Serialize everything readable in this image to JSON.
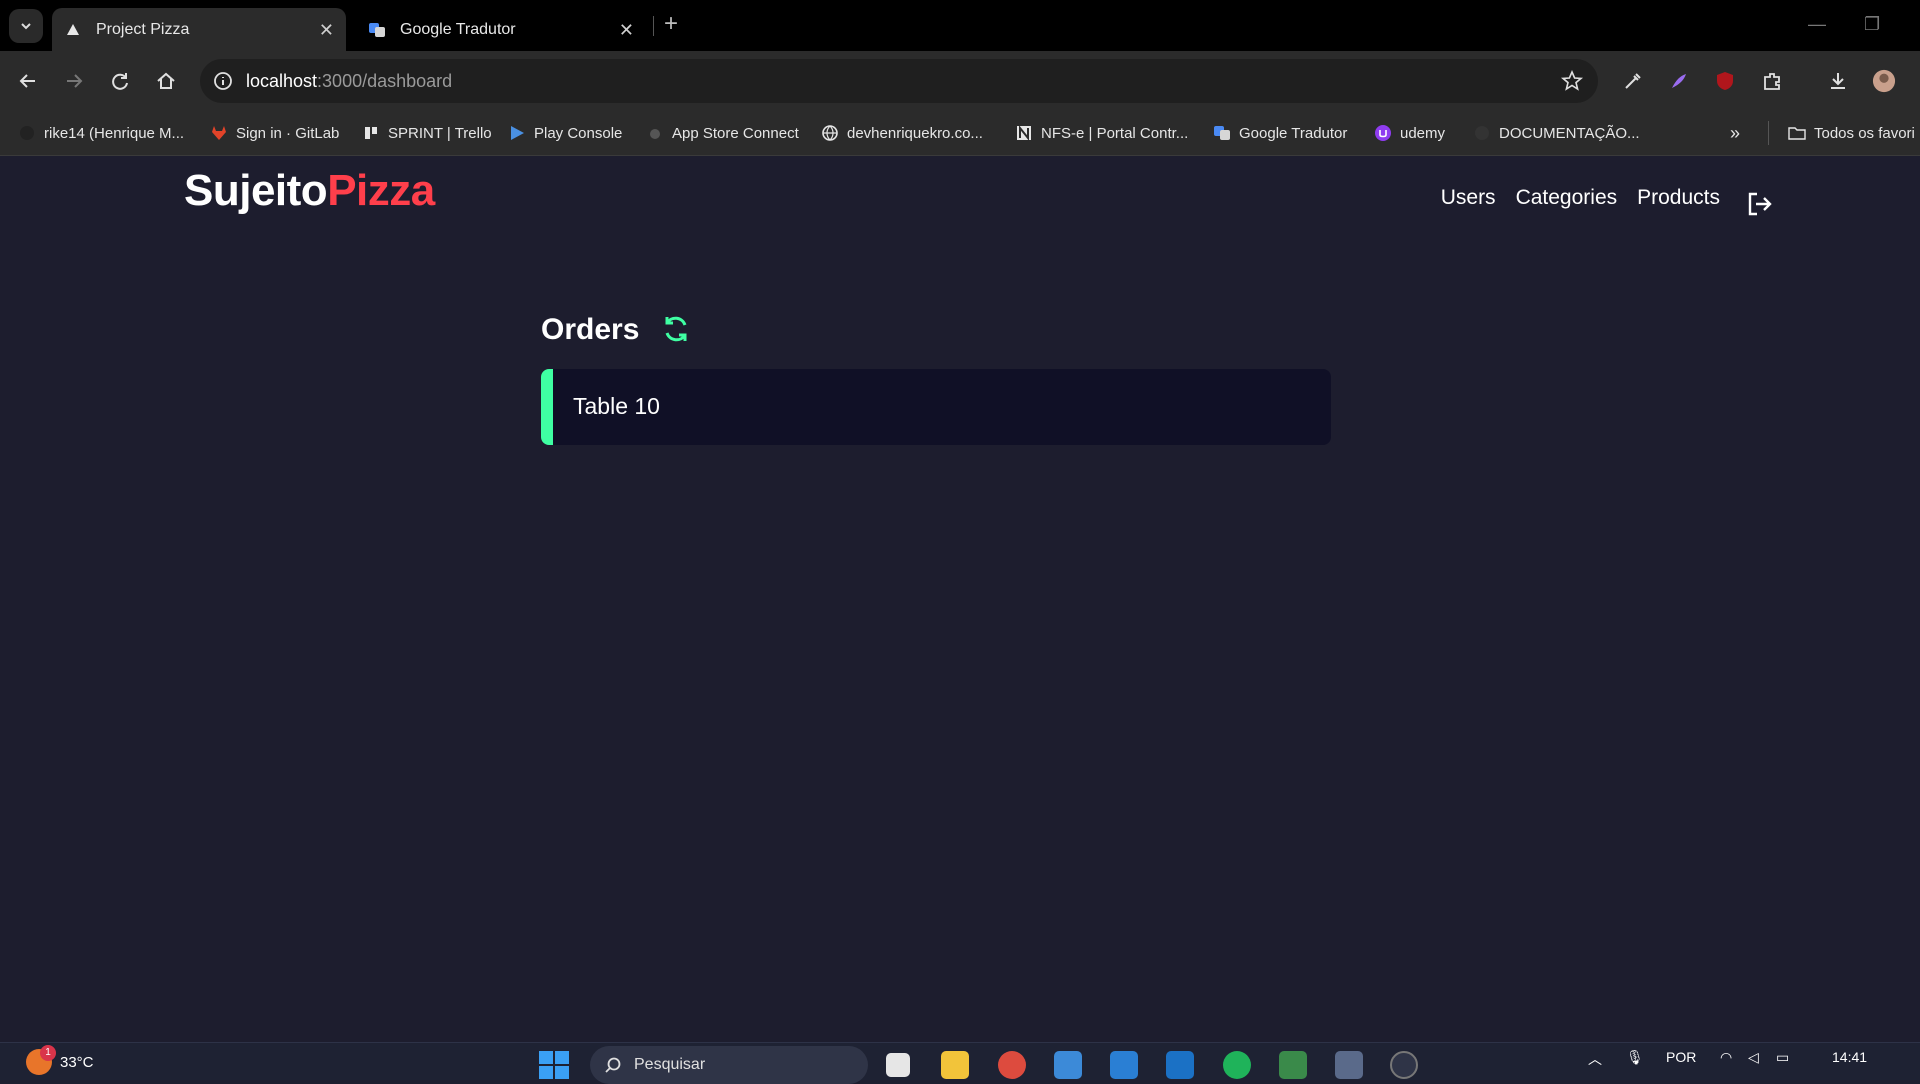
{
  "browser": {
    "tabs": [
      {
        "title": "Project Pizza",
        "active": true
      },
      {
        "title": "Google Tradutor",
        "active": false
      }
    ],
    "url_host": "localhost",
    "url_path": ":3000/dashboard",
    "bookmarks": [
      "rike14 (Henrique M...",
      "Sign in · GitLab",
      "SPRINT | Trello",
      "Play Console",
      "App Store Connect",
      "devhenriquekro.co...",
      "NFS-e | Portal Contr...",
      "Google Tradutor",
      "udemy",
      "DOCUMENTAÇÃO..."
    ],
    "bookmarks_overflow": "»",
    "all_bookmarks": "Todos os favori"
  },
  "app": {
    "logo_part1": "Sujeito",
    "logo_part2": "Pizza",
    "nav": [
      "Users",
      "Categories",
      "Products"
    ],
    "orders_title": "Orders",
    "orders": [
      {
        "label": "Table 10"
      }
    ],
    "colors": {
      "accent_red": "#ff3f4b",
      "accent_green": "#3fffa3",
      "background": "#1d1d2e"
    }
  },
  "taskbar": {
    "temperature": "33°C",
    "weather_badge": "1",
    "search_placeholder": "Pesquisar",
    "language": "POR",
    "time": "14:41"
  }
}
